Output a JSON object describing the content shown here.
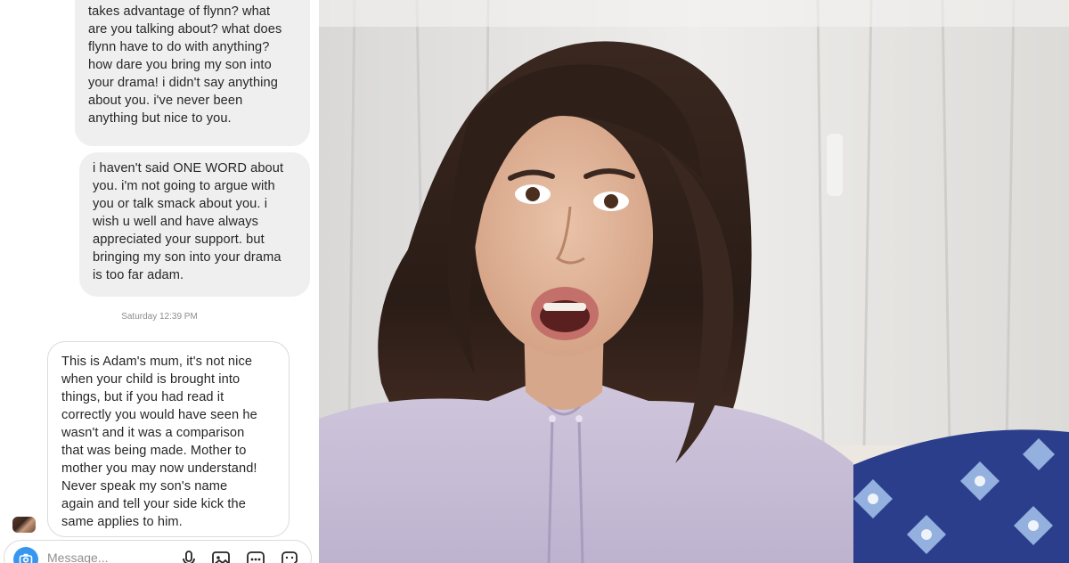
{
  "chat": {
    "messages": [
      {
        "id": "bubble-1",
        "direction": "outgoing",
        "text": "takes advantage of flynn? what\nare you talking about? what does\nflynn have to do with anything?\nhow dare you bring my son into\nyour drama! i didn't say anything\nabout you. i've never been\nanything but nice to you."
      },
      {
        "id": "bubble-2",
        "direction": "outgoing",
        "text": "i haven't said ONE WORD about\nyou. i'm not going to argue with\nyou or talk smack about you. i\nwish u well and have always\nappreciated your support. but\nbringing my son into your drama\nis too far adam."
      },
      {
        "id": "bubble-3",
        "direction": "incoming",
        "text": "This is Adam's mum, it's not nice\nwhen your child is brought into\nthings, but if you had read it\ncorrectly you would have seen he\nwasn't and it was a comparison\nthat was being made. Mother to\nmother you may now understand!\nNever speak my son's name\nagain and tell your side kick the\nsame applies to him."
      }
    ],
    "timestamp": "Saturday 12:39 PM",
    "composer": {
      "placeholder": "Message...",
      "icons": [
        "camera-icon",
        "microphone-icon",
        "image-icon",
        "more-icon",
        "sticker-icon"
      ]
    }
  },
  "colors": {
    "outgoing_bubble": "#efefef",
    "incoming_border": "#dbdbdb",
    "camera_button": "#3797f0",
    "timestamp": "#8e8e8e"
  }
}
